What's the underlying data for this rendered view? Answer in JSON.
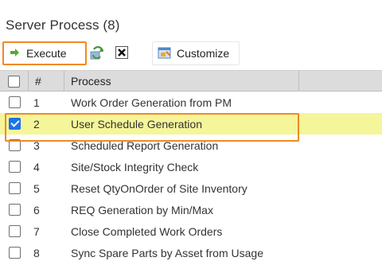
{
  "title": "Server Process (8)",
  "toolbar": {
    "execute_label": "Execute",
    "customize_label": "Customize",
    "icons": [
      "green-arrow-icon",
      "refresh-icon",
      "close-icon",
      "customize-icon"
    ]
  },
  "grid": {
    "headers": {
      "num": "#",
      "process": "Process"
    },
    "rows": [
      {
        "num": "1",
        "process": "Work Order Generation from PM",
        "checked": false
      },
      {
        "num": "2",
        "process": "User Schedule Generation",
        "checked": true
      },
      {
        "num": "3",
        "process": "Scheduled Report Generation",
        "checked": false
      },
      {
        "num": "4",
        "process": "Site/Stock Integrity Check",
        "checked": false
      },
      {
        "num": "5",
        "process": "Reset QtyOnOrder of Site Inventory",
        "checked": false
      },
      {
        "num": "6",
        "process": "REQ Generation by Min/Max",
        "checked": false
      },
      {
        "num": "7",
        "process": "Close Completed Work Orders",
        "checked": false
      },
      {
        "num": "8",
        "process": "Sync Spare Parts by Asset from Usage",
        "checked": false
      }
    ]
  },
  "colors": {
    "highlight_border": "#f08a24",
    "selected_row": "#f5f59a",
    "checkbox_checked": "#1a73e8",
    "header_bg": "#dcdcdc"
  }
}
